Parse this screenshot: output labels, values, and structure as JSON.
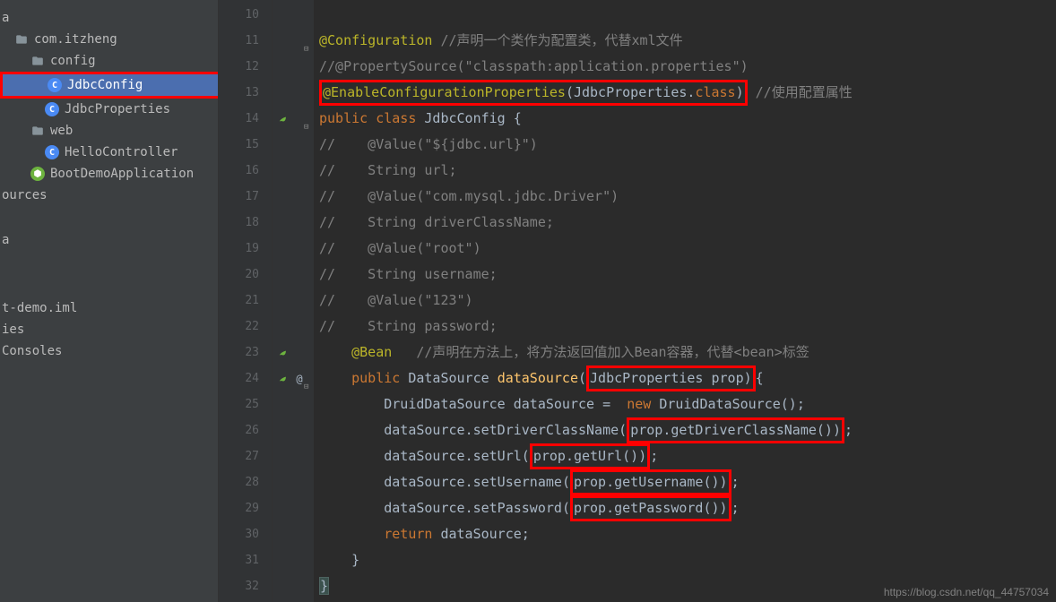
{
  "sidebar": {
    "items": [
      {
        "label": "a",
        "type": "plain",
        "indent": 0
      },
      {
        "label": "com.itzheng",
        "type": "folder",
        "indent": 1
      },
      {
        "label": "config",
        "type": "folder",
        "indent": 2
      },
      {
        "label": "JdbcConfig",
        "type": "class",
        "indent": 3,
        "selected": true,
        "redbox": true
      },
      {
        "label": "JdbcProperties",
        "type": "class",
        "indent": 3
      },
      {
        "label": "web",
        "type": "folder",
        "indent": 2
      },
      {
        "label": "HelloController",
        "type": "class",
        "indent": 3
      },
      {
        "label": "BootDemoApplication",
        "type": "spring",
        "indent": 2
      },
      {
        "label": "ources",
        "type": "plain",
        "indent": 0
      },
      {
        "label": "",
        "type": "spacer"
      },
      {
        "label": "a",
        "type": "plain",
        "indent": 0
      },
      {
        "label": "",
        "type": "spacer"
      },
      {
        "label": "",
        "type": "spacer"
      },
      {
        "label": "t-demo.iml",
        "type": "plain",
        "indent": 0
      },
      {
        "label": "ies",
        "type": "plain",
        "indent": 0
      },
      {
        "label": " Consoles",
        "type": "plain",
        "indent": 0
      }
    ]
  },
  "gutter": {
    "start": 10,
    "end": 32,
    "markers": {
      "14": [
        "leaf"
      ],
      "23": [
        "leaf"
      ],
      "24": [
        "leaf",
        "at"
      ]
    },
    "folds": [
      11,
      14,
      24
    ]
  },
  "code": {
    "lines": {
      "10": "",
      "11": {
        "tokens": [
          [
            "annotation",
            "@Configuration"
          ],
          [
            "plain",
            " "
          ],
          [
            "comment",
            "//声明一个类作为配置类，代替xml文件"
          ]
        ],
        "fold": true
      },
      "12": {
        "tokens": [
          [
            "comment",
            "//@PropertySource(\"classpath:application.properties\")"
          ]
        ]
      },
      "13": {
        "tokens": [
          [
            "redbox-start",
            ""
          ],
          [
            "annotation",
            "@EnableConfigurationProperties"
          ],
          [
            "punct",
            "("
          ],
          [
            "ident",
            "JdbcProperties"
          ],
          [
            "punct",
            "."
          ],
          [
            "keyword",
            "class"
          ],
          [
            "punct",
            ")"
          ],
          [
            "redbox-end",
            ""
          ],
          [
            "plain",
            " "
          ],
          [
            "comment",
            "//使用配置属性"
          ]
        ]
      },
      "14": {
        "tokens": [
          [
            "keyword",
            "public class "
          ],
          [
            "ident",
            "JdbcConfig "
          ],
          [
            "punct",
            "{"
          ]
        ],
        "fold": true
      },
      "15": {
        "tokens": [
          [
            "comment",
            "//    @Value(\"${jdbc.url}\")"
          ]
        ]
      },
      "16": {
        "tokens": [
          [
            "comment",
            "//    String url;"
          ]
        ]
      },
      "17": {
        "tokens": [
          [
            "comment",
            "//    @Value(\"com.mysql.jdbc.Driver\")"
          ]
        ]
      },
      "18": {
        "tokens": [
          [
            "comment",
            "//    String driverClassName;"
          ]
        ]
      },
      "19": {
        "tokens": [
          [
            "comment",
            "//    @Value(\"root\")"
          ]
        ]
      },
      "20": {
        "tokens": [
          [
            "comment",
            "//    String username;"
          ]
        ]
      },
      "21": {
        "tokens": [
          [
            "comment",
            "//    @Value(\"123\")"
          ]
        ]
      },
      "22": {
        "tokens": [
          [
            "comment",
            "//    String password;"
          ]
        ]
      },
      "23": {
        "tokens": [
          [
            "plain",
            "    "
          ],
          [
            "annotation",
            "@Bean"
          ],
          [
            "plain",
            "   "
          ],
          [
            "comment",
            "//声明在方法上，将方法返回值加入Bean容器，代替<bean>标签"
          ]
        ]
      },
      "24": {
        "tokens": [
          [
            "plain",
            "    "
          ],
          [
            "keyword",
            "public "
          ],
          [
            "ident",
            "DataSource "
          ],
          [
            "method",
            "dataSource"
          ],
          [
            "punct",
            "("
          ],
          [
            "redbox-start",
            ""
          ],
          [
            "ident",
            "JdbcProperties prop"
          ],
          [
            "punct",
            ")"
          ],
          [
            "redbox-end",
            ""
          ],
          [
            "punct",
            "{"
          ]
        ],
        "fold": true
      },
      "25": {
        "tokens": [
          [
            "plain",
            "        "
          ],
          [
            "ident",
            "DruidDataSource dataSource"
          ],
          [
            "plain",
            " =  "
          ],
          [
            "keyword",
            "new "
          ],
          [
            "ident",
            "DruidDataSource"
          ],
          [
            "punct",
            "();"
          ]
        ]
      },
      "26": {
        "tokens": [
          [
            "plain",
            "        "
          ],
          [
            "ident",
            "dataSource"
          ],
          [
            "punct",
            "."
          ],
          [
            "ident",
            "setDriverClassName"
          ],
          [
            "punct",
            "("
          ],
          [
            "redbox-start",
            ""
          ],
          [
            "ident",
            "prop"
          ],
          [
            "punct",
            "."
          ],
          [
            "ident",
            "getDriverClassName"
          ],
          [
            "paren",
            "()"
          ],
          [
            "punct",
            ")"
          ],
          [
            "redbox-end",
            ""
          ],
          [
            "punct",
            ";"
          ]
        ]
      },
      "27": {
        "tokens": [
          [
            "plain",
            "        "
          ],
          [
            "ident",
            "dataSource"
          ],
          [
            "punct",
            "."
          ],
          [
            "ident",
            "setUrl"
          ],
          [
            "punct",
            "("
          ],
          [
            "redbox-start",
            ""
          ],
          [
            "ident",
            "prop"
          ],
          [
            "punct",
            "."
          ],
          [
            "ident",
            "getUrl"
          ],
          [
            "paren",
            "()"
          ],
          [
            "punct",
            ")"
          ],
          [
            "redbox-end",
            ""
          ],
          [
            "punct",
            ";"
          ]
        ]
      },
      "28": {
        "tokens": [
          [
            "plain",
            "        "
          ],
          [
            "ident",
            "dataSource"
          ],
          [
            "punct",
            "."
          ],
          [
            "ident",
            "setUsername"
          ],
          [
            "punct",
            "("
          ],
          [
            "redbox-start",
            ""
          ],
          [
            "ident",
            "prop"
          ],
          [
            "punct",
            "."
          ],
          [
            "ident",
            "getUsername"
          ],
          [
            "paren",
            "()"
          ],
          [
            "punct",
            ")"
          ],
          [
            "redbox-end",
            ""
          ],
          [
            "punct",
            ";"
          ]
        ]
      },
      "29": {
        "tokens": [
          [
            "plain",
            "        "
          ],
          [
            "ident",
            "dataSource"
          ],
          [
            "punct",
            "."
          ],
          [
            "ident",
            "setPassword"
          ],
          [
            "punct",
            "("
          ],
          [
            "redbox-start",
            ""
          ],
          [
            "ident",
            "prop"
          ],
          [
            "punct",
            "."
          ],
          [
            "ident",
            "getPassword"
          ],
          [
            "paren",
            "()"
          ],
          [
            "punct",
            ")"
          ],
          [
            "redbox-end",
            ""
          ],
          [
            "punct",
            ";"
          ]
        ]
      },
      "30": {
        "tokens": [
          [
            "plain",
            "        "
          ],
          [
            "keyword",
            "return "
          ],
          [
            "ident",
            "dataSource"
          ],
          [
            "punct",
            ";"
          ]
        ]
      },
      "31": {
        "tokens": [
          [
            "plain",
            "    "
          ],
          [
            "punct",
            "}"
          ]
        ]
      },
      "32": {
        "tokens": [
          [
            "brace-hl",
            "}"
          ]
        ]
      }
    }
  },
  "watermark": "https://blog.csdn.net/qq_44757034"
}
